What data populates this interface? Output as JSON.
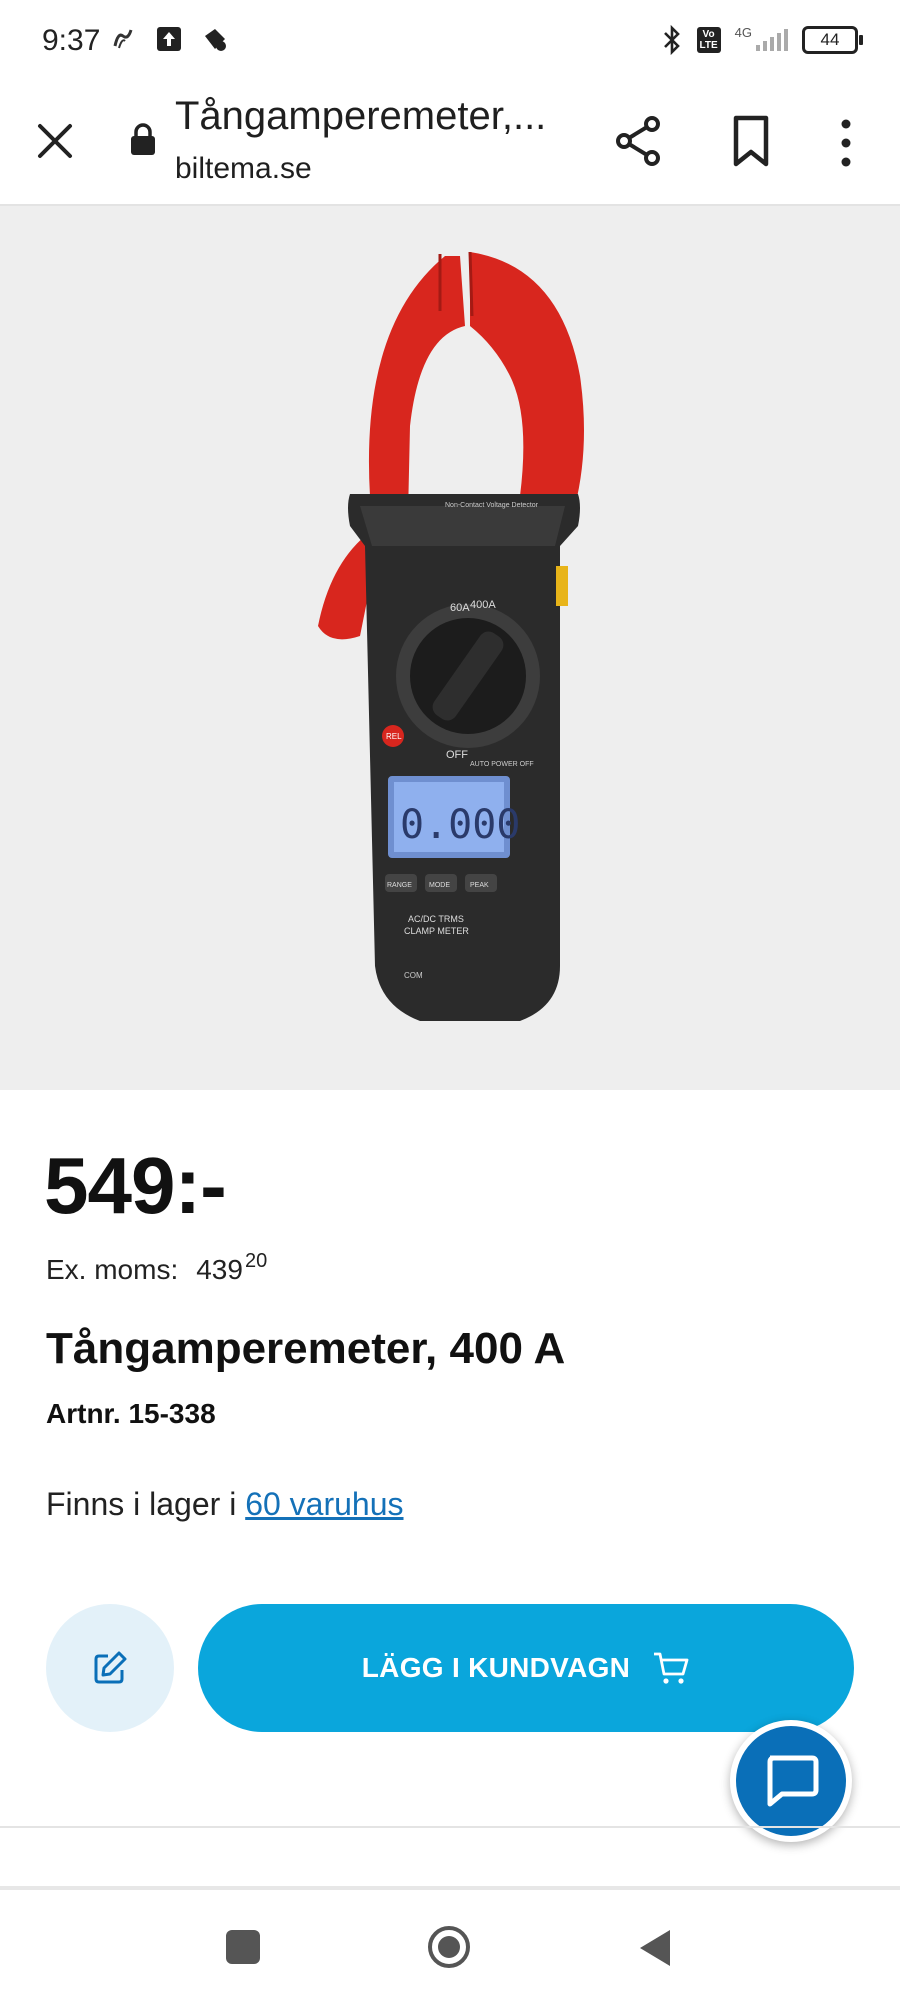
{
  "status_bar": {
    "time": "9:37",
    "network": "4G",
    "lte": "Vo\nLTE",
    "battery": "44"
  },
  "browser": {
    "page_title": "Tångamperemeter,...",
    "domain": "biltema.se"
  },
  "product": {
    "price": "549:-",
    "ex_moms_label": "Ex. moms:",
    "ex_moms_main": "439",
    "ex_moms_cents": "20",
    "title": "Tångamperemeter, 400 A",
    "artnr": "Artnr. 15-338",
    "stock_prefix": "Finns i lager i ",
    "stock_link": "60 varuhus"
  },
  "actions": {
    "add_to_cart": "LÄGG I KUNDVAGN"
  },
  "device_image": {
    "clamp_label": "Non-Contact Voltage Detector",
    "dial_60a": "60A",
    "dial_400a": "400A",
    "rel": "REL",
    "off": "OFF",
    "auto_power_off": "AUTO POWER OFF",
    "display_value": "0.000",
    "btn_range": "RANGE",
    "btn_mode": "MODE",
    "btn_peak": "PEAK",
    "model_line1": "AC/DC TRMS",
    "model_line2": "CLAMP METER",
    "com": "COM"
  },
  "colors": {
    "accent": "#0aa6dc",
    "link": "#1471b8",
    "chat": "#0a6fb8",
    "clamp_red": "#d8261e"
  }
}
